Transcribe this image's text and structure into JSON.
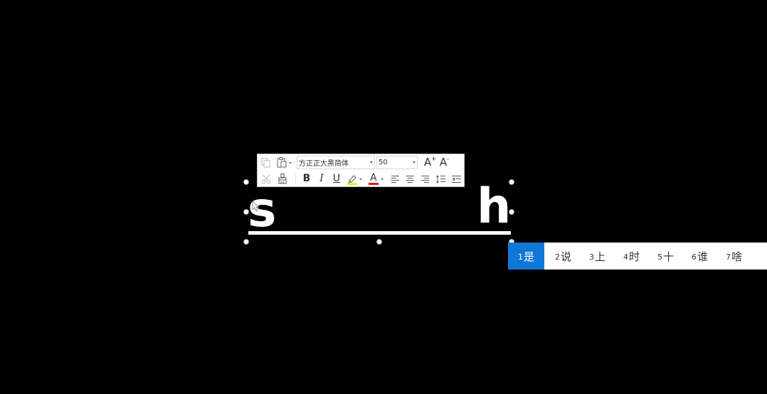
{
  "toolbar": {
    "font_name": "方正正大黑简体",
    "font_size": "50",
    "bold_label": "B",
    "italic_label": "I",
    "underline_label": "U",
    "font_color_label": "A",
    "grow_font_label": "A",
    "shrink_font_label": "A",
    "grow_font_sign": "+",
    "shrink_font_sign": "-",
    "highlight_color": "#f5e600",
    "font_color": "#d81e06"
  },
  "textbox": {
    "letter_left": "s",
    "letter_right": "h"
  },
  "ime": {
    "candidates": [
      {
        "num": "1",
        "char": "是"
      },
      {
        "num": "2",
        "char": "说"
      },
      {
        "num": "3",
        "char": "上"
      },
      {
        "num": "4",
        "char": "时"
      },
      {
        "num": "5",
        "char": "十"
      },
      {
        "num": "6",
        "char": "谁"
      },
      {
        "num": "7",
        "char": "啥"
      }
    ],
    "selected_color": "#0f78d7"
  }
}
